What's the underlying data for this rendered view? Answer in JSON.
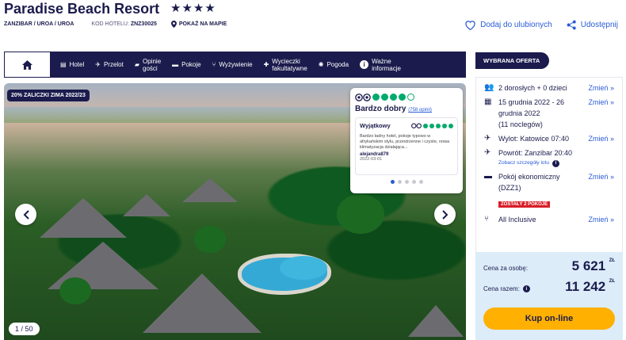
{
  "header": {
    "title": "Paradise Beach Resort",
    "stars": "★★★★",
    "breadcrumb": "ZANZIBAR / UROA / UROA",
    "code_label": "KOD HOTELU:",
    "code_value": "ZNZ30025",
    "map_link": "POKAŻ NA MAPIE",
    "favorite": "Dodaj do ulubionych",
    "share": "Udostępnij"
  },
  "nav": {
    "items": [
      {
        "label": "Hotel",
        "icon": "hotel-icon"
      },
      {
        "label": "Przelot",
        "icon": "plane-icon"
      },
      {
        "label": "Opinie\ngości",
        "icon": "comment-icon"
      },
      {
        "label": "Pokoje",
        "icon": "bed-icon"
      },
      {
        "label": "Wyżywienie",
        "icon": "cutlery-icon"
      },
      {
        "label": "Wycieczki\nfakultatywne",
        "icon": "excursion-icon"
      },
      {
        "label": "Pogoda",
        "icon": "sun-icon"
      },
      {
        "label": "Ważne\ninformacje",
        "icon": "info-icon"
      }
    ]
  },
  "gallery": {
    "promo_badge": "20% ZALICZKI ZIMA 2022/23",
    "counter": "1 / 50"
  },
  "review": {
    "rating_dots": 4,
    "rating_label": "Bardzo dobry",
    "reviews_link": "(758 opinii)",
    "title": "Wyjątkowy",
    "text": "Bardzo ładny hotel, pokoje typowo w afrykańskim stylu, przestrzenne i czyste, nowa klimatyzacja działająca...",
    "author": "alejandra879",
    "date": "2022-03-01"
  },
  "offer": {
    "tag": "WYBRANA OFERTA",
    "change_label": "Zmień »",
    "guests": "2 dorosłych + 0 dzieci",
    "dates_line1": "15 grudnia 2022 - 26",
    "dates_line2": "grudnia 2022",
    "nights": "(11 noclegów)",
    "departure": "Wylot: Katowice 07:40",
    "return": "Powrót: Zanzibar 20:40",
    "flight_details": "Zobacz szczegóły lotu",
    "room_line1": "Pokój ekonomiczny",
    "room_line2": "(DZZ1)",
    "rooms_left": "ZOSTAŁY 2 POKOJE",
    "board": "All Inclusive"
  },
  "price": {
    "per_person_label": "Cena za osobę:",
    "per_person_value": "5 621",
    "total_label": "Cena razem:",
    "total_value": "11 242",
    "currency": "ZŁ",
    "buy_button": "Kup on-line"
  }
}
